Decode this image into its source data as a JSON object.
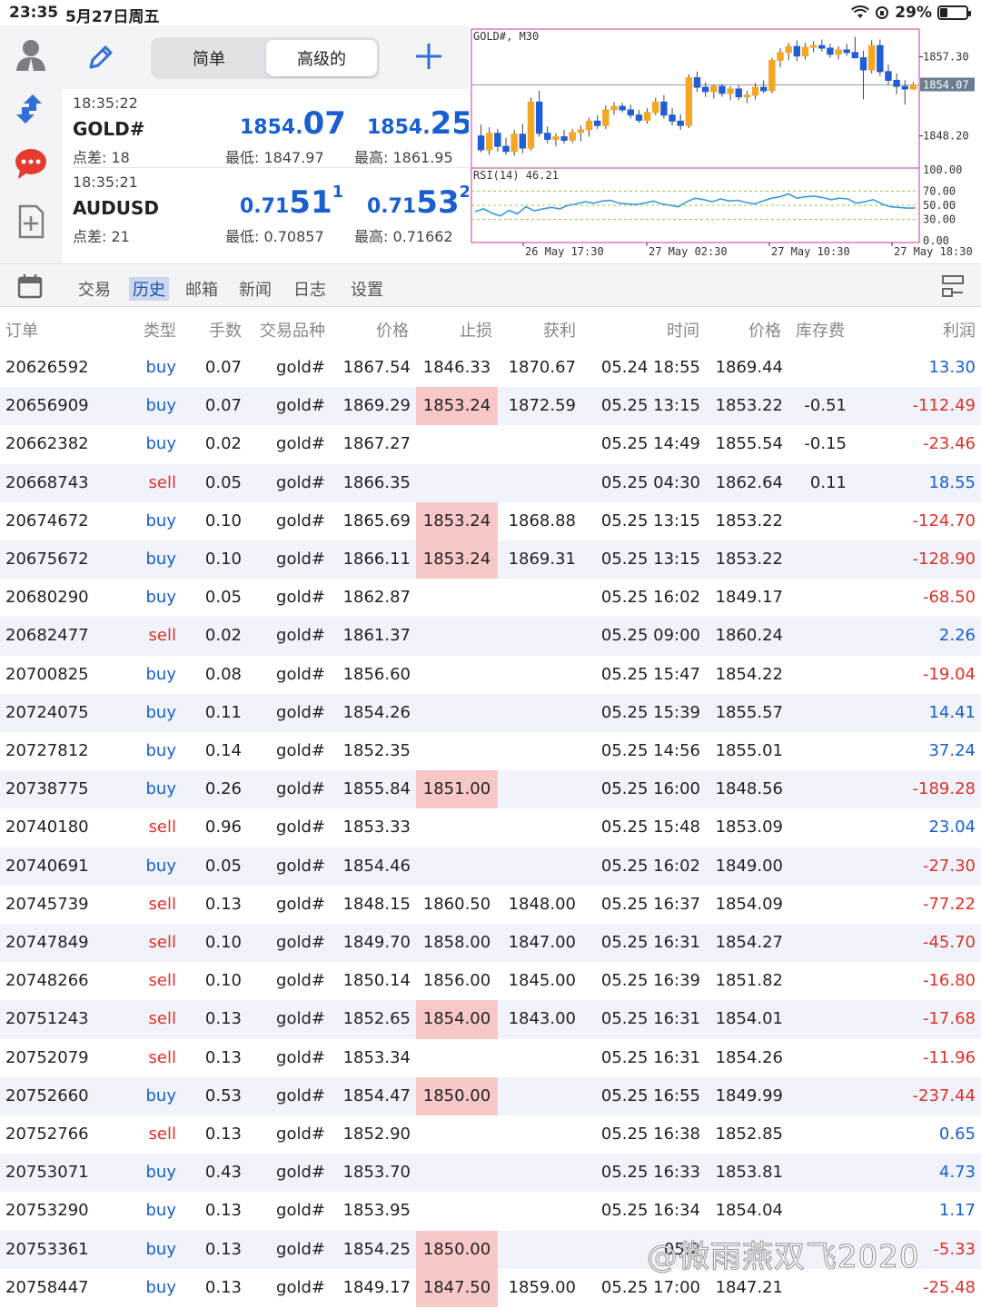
{
  "status_bar": {
    "time": "23:35",
    "date": "5月27日周五",
    "battery": "29%"
  },
  "toolbar": {
    "simple_label": "简单",
    "advanced_label": "高级的"
  },
  "quotes": [
    {
      "time": "18:35:22",
      "symbol": "GOLD#",
      "spread": "点差: 18",
      "bid_small": "1854.",
      "bid_big": "07",
      "bid_sup": "",
      "ask_small": "1854.",
      "ask_big": "25",
      "ask_sup": "",
      "low": "最低: 1847.97",
      "high": "最高: 1861.95"
    },
    {
      "time": "18:35:21",
      "symbol": "AUDUSD",
      "spread": "点差: 21",
      "bid_small": "0.71",
      "bid_big": "51",
      "bid_sup": "1",
      "ask_small": "0.71",
      "ask_big": "53",
      "ask_sup": "2",
      "low": "最低: 0.70857",
      "high": "最高: 0.71662"
    }
  ],
  "chart": {
    "title": "GOLD#, M30",
    "price_ticks": [
      "1857.30",
      "1854.07",
      "1848.20"
    ],
    "rsi_label": "RSI(14) 46.21",
    "rsi_ticks": [
      "100.00",
      "70.00",
      "50.00",
      "30.00",
      "0.00"
    ],
    "time_ticks": [
      "26 May 17:30",
      "27 May 02:30",
      "27 May 10:30",
      "27 May 18:30"
    ],
    "colors": {
      "up": "#f5a623",
      "down": "#1f5fd6",
      "rsi": "#3a9ad9",
      "level": "#9ac43a",
      "frame": "#c8389a"
    }
  },
  "chart_data": {
    "type": "candlestick",
    "title": "GOLD#, M30",
    "price_ylim": [
      1844.5,
      1860.5
    ],
    "current_price": 1854.07,
    "candles": [
      {
        "o": 1848.2,
        "h": 1849.5,
        "l": 1846.3,
        "c": 1846.6
      },
      {
        "o": 1846.6,
        "h": 1849.2,
        "l": 1846.0,
        "c": 1848.5
      },
      {
        "o": 1848.5,
        "h": 1849.0,
        "l": 1846.4,
        "c": 1847.0
      },
      {
        "o": 1847.0,
        "h": 1848.0,
        "l": 1846.0,
        "c": 1846.4
      },
      {
        "o": 1846.4,
        "h": 1848.9,
        "l": 1845.9,
        "c": 1848.4
      },
      {
        "o": 1848.4,
        "h": 1849.6,
        "l": 1846.2,
        "c": 1846.8
      },
      {
        "o": 1846.8,
        "h": 1852.6,
        "l": 1846.5,
        "c": 1852.1
      },
      {
        "o": 1852.1,
        "h": 1853.4,
        "l": 1848.1,
        "c": 1848.5
      },
      {
        "o": 1848.5,
        "h": 1849.3,
        "l": 1847.3,
        "c": 1847.8
      },
      {
        "o": 1847.8,
        "h": 1848.5,
        "l": 1847.0,
        "c": 1848.1
      },
      {
        "o": 1848.1,
        "h": 1848.9,
        "l": 1847.3,
        "c": 1847.7
      },
      {
        "o": 1847.7,
        "h": 1849.0,
        "l": 1847.4,
        "c": 1848.6
      },
      {
        "o": 1848.6,
        "h": 1849.4,
        "l": 1847.6,
        "c": 1848.9
      },
      {
        "o": 1848.9,
        "h": 1850.3,
        "l": 1848.1,
        "c": 1849.9
      },
      {
        "o": 1849.9,
        "h": 1850.6,
        "l": 1849.0,
        "c": 1849.4
      },
      {
        "o": 1849.4,
        "h": 1851.7,
        "l": 1849.0,
        "c": 1851.2
      },
      {
        "o": 1851.2,
        "h": 1852.1,
        "l": 1850.6,
        "c": 1851.6
      },
      {
        "o": 1851.6,
        "h": 1852.0,
        "l": 1850.9,
        "c": 1851.2
      },
      {
        "o": 1851.2,
        "h": 1851.8,
        "l": 1850.2,
        "c": 1850.6
      },
      {
        "o": 1850.6,
        "h": 1851.2,
        "l": 1849.7,
        "c": 1850.0
      },
      {
        "o": 1850.0,
        "h": 1851.4,
        "l": 1849.6,
        "c": 1850.9
      },
      {
        "o": 1850.9,
        "h": 1852.6,
        "l": 1850.6,
        "c": 1852.1
      },
      {
        "o": 1852.1,
        "h": 1852.9,
        "l": 1850.2,
        "c": 1850.6
      },
      {
        "o": 1850.6,
        "h": 1851.4,
        "l": 1849.4,
        "c": 1849.9
      },
      {
        "o": 1849.9,
        "h": 1850.7,
        "l": 1848.9,
        "c": 1849.4
      },
      {
        "o": 1849.4,
        "h": 1855.3,
        "l": 1849.1,
        "c": 1854.9
      },
      {
        "o": 1854.9,
        "h": 1855.6,
        "l": 1853.3,
        "c": 1853.8
      },
      {
        "o": 1853.8,
        "h": 1854.4,
        "l": 1852.7,
        "c": 1853.3
      },
      {
        "o": 1853.3,
        "h": 1854.1,
        "l": 1852.5,
        "c": 1853.9
      },
      {
        "o": 1853.9,
        "h": 1854.2,
        "l": 1852.7,
        "c": 1853.1
      },
      {
        "o": 1853.1,
        "h": 1853.9,
        "l": 1852.3,
        "c": 1853.6
      },
      {
        "o": 1853.6,
        "h": 1854.0,
        "l": 1852.3,
        "c": 1852.7
      },
      {
        "o": 1852.7,
        "h": 1853.4,
        "l": 1852.0,
        "c": 1852.9
      },
      {
        "o": 1852.9,
        "h": 1854.3,
        "l": 1852.4,
        "c": 1853.8
      },
      {
        "o": 1853.8,
        "h": 1854.6,
        "l": 1853.1,
        "c": 1853.4
      },
      {
        "o": 1853.4,
        "h": 1857.2,
        "l": 1853.1,
        "c": 1856.9
      },
      {
        "o": 1856.9,
        "h": 1858.3,
        "l": 1856.1,
        "c": 1857.8
      },
      {
        "o": 1857.8,
        "h": 1858.9,
        "l": 1856.9,
        "c": 1858.5
      },
      {
        "o": 1858.5,
        "h": 1859.2,
        "l": 1856.8,
        "c": 1857.4
      },
      {
        "o": 1857.4,
        "h": 1858.9,
        "l": 1857.0,
        "c": 1858.4
      },
      {
        "o": 1858.4,
        "h": 1859.1,
        "l": 1857.8,
        "c": 1858.6
      },
      {
        "o": 1858.6,
        "h": 1859.3,
        "l": 1857.9,
        "c": 1858.3
      },
      {
        "o": 1858.3,
        "h": 1858.8,
        "l": 1857.2,
        "c": 1857.6
      },
      {
        "o": 1857.6,
        "h": 1858.5,
        "l": 1857.0,
        "c": 1858.1
      },
      {
        "o": 1858.1,
        "h": 1858.8,
        "l": 1857.4,
        "c": 1857.8
      },
      {
        "o": 1857.8,
        "h": 1859.6,
        "l": 1857.1,
        "c": 1857.2
      },
      {
        "o": 1857.2,
        "h": 1858.0,
        "l": 1852.4,
        "c": 1855.8
      },
      {
        "o": 1855.8,
        "h": 1859.2,
        "l": 1855.4,
        "c": 1858.6
      },
      {
        "o": 1858.6,
        "h": 1859.3,
        "l": 1855.1,
        "c": 1855.6
      },
      {
        "o": 1855.6,
        "h": 1856.4,
        "l": 1854.1,
        "c": 1854.6
      },
      {
        "o": 1854.6,
        "h": 1855.4,
        "l": 1853.0,
        "c": 1853.9
      },
      {
        "o": 1853.9,
        "h": 1854.6,
        "l": 1851.8,
        "c": 1853.6
      },
      {
        "o": 1853.6,
        "h": 1854.4,
        "l": 1853.5,
        "c": 1854.07
      }
    ],
    "rsi": {
      "label": "RSI(14) 46.21",
      "ylim": [
        0,
        100
      ],
      "levels": [
        70,
        50,
        30
      ],
      "values": [
        41,
        45,
        39,
        35,
        43,
        38,
        48,
        42,
        45,
        47,
        45,
        50,
        52,
        55,
        53,
        56,
        57,
        53,
        52,
        51,
        53,
        56,
        52,
        50,
        48,
        55,
        60,
        58,
        55,
        59,
        56,
        57,
        54,
        52,
        56,
        60,
        62,
        66,
        60,
        62,
        63,
        61,
        58,
        60,
        59,
        53,
        55,
        58,
        52,
        48,
        47,
        46,
        46.21
      ]
    },
    "x_tick_labels": [
      "26 May 17:30",
      "27 May 02:30",
      "27 May 10:30",
      "27 May 18:30"
    ],
    "y_tick_labels": [
      "1857.30",
      "1854.07",
      "1848.20"
    ],
    "rsi_tick_labels": [
      "100.00",
      "70.00",
      "50.00",
      "30.00",
      "0.00"
    ]
  },
  "tabs": [
    "交易",
    "历史",
    "邮箱",
    "新闻",
    "日志",
    "设置"
  ],
  "table": {
    "headers": {
      "order": "订单",
      "type": "类型",
      "volume": "手数",
      "symbol": "交易品种",
      "price": "价格",
      "sl": "止损",
      "tp": "获利",
      "time": "时间",
      "close_price": "价格",
      "swap": "库存费",
      "profit": "利润"
    },
    "rows": [
      {
        "order": "20626592",
        "type": "buy",
        "volume": "0.07",
        "symbol": "gold#",
        "price": "1867.54",
        "sl": "1846.33",
        "tp": "1870.67",
        "time": "05.24 18:55",
        "close_price": "1869.44",
        "swap": "",
        "profit": "13.30",
        "sl_hit": false
      },
      {
        "order": "20656909",
        "type": "buy",
        "volume": "0.07",
        "symbol": "gold#",
        "price": "1869.29",
        "sl": "1853.24",
        "tp": "1872.59",
        "time": "05.25 13:15",
        "close_price": "1853.22",
        "swap": "-0.51",
        "profit": "-112.49",
        "sl_hit": true
      },
      {
        "order": "20662382",
        "type": "buy",
        "volume": "0.02",
        "symbol": "gold#",
        "price": "1867.27",
        "sl": "",
        "tp": "",
        "time": "05.25 14:49",
        "close_price": "1855.54",
        "swap": "-0.15",
        "profit": "-23.46",
        "sl_hit": false
      },
      {
        "order": "20668743",
        "type": "sell",
        "volume": "0.05",
        "symbol": "gold#",
        "price": "1866.35",
        "sl": "",
        "tp": "",
        "time": "05.25 04:30",
        "close_price": "1862.64",
        "swap": "0.11",
        "profit": "18.55",
        "sl_hit": false
      },
      {
        "order": "20674672",
        "type": "buy",
        "volume": "0.10",
        "symbol": "gold#",
        "price": "1865.69",
        "sl": "1853.24",
        "tp": "1868.88",
        "time": "05.25 13:15",
        "close_price": "1853.22",
        "swap": "",
        "profit": "-124.70",
        "sl_hit": true
      },
      {
        "order": "20675672",
        "type": "buy",
        "volume": "0.10",
        "symbol": "gold#",
        "price": "1866.11",
        "sl": "1853.24",
        "tp": "1869.31",
        "time": "05.25 13:15",
        "close_price": "1853.22",
        "swap": "",
        "profit": "-128.90",
        "sl_hit": true
      },
      {
        "order": "20680290",
        "type": "buy",
        "volume": "0.05",
        "symbol": "gold#",
        "price": "1862.87",
        "sl": "",
        "tp": "",
        "time": "05.25 16:02",
        "close_price": "1849.17",
        "swap": "",
        "profit": "-68.50",
        "sl_hit": false
      },
      {
        "order": "20682477",
        "type": "sell",
        "volume": "0.02",
        "symbol": "gold#",
        "price": "1861.37",
        "sl": "",
        "tp": "",
        "time": "05.25 09:00",
        "close_price": "1860.24",
        "swap": "",
        "profit": "2.26",
        "sl_hit": false
      },
      {
        "order": "20700825",
        "type": "buy",
        "volume": "0.08",
        "symbol": "gold#",
        "price": "1856.60",
        "sl": "",
        "tp": "",
        "time": "05.25 15:47",
        "close_price": "1854.22",
        "swap": "",
        "profit": "-19.04",
        "sl_hit": false
      },
      {
        "order": "20724075",
        "type": "buy",
        "volume": "0.11",
        "symbol": "gold#",
        "price": "1854.26",
        "sl": "",
        "tp": "",
        "time": "05.25 15:39",
        "close_price": "1855.57",
        "swap": "",
        "profit": "14.41",
        "sl_hit": false
      },
      {
        "order": "20727812",
        "type": "buy",
        "volume": "0.14",
        "symbol": "gold#",
        "price": "1852.35",
        "sl": "",
        "tp": "",
        "time": "05.25 14:56",
        "close_price": "1855.01",
        "swap": "",
        "profit": "37.24",
        "sl_hit": false
      },
      {
        "order": "20738775",
        "type": "buy",
        "volume": "0.26",
        "symbol": "gold#",
        "price": "1855.84",
        "sl": "1851.00",
        "tp": "",
        "time": "05.25 16:00",
        "close_price": "1848.56",
        "swap": "",
        "profit": "-189.28",
        "sl_hit": true
      },
      {
        "order": "20740180",
        "type": "sell",
        "volume": "0.96",
        "symbol": "gold#",
        "price": "1853.33",
        "sl": "",
        "tp": "",
        "time": "05.25 15:48",
        "close_price": "1853.09",
        "swap": "",
        "profit": "23.04",
        "sl_hit": false
      },
      {
        "order": "20740691",
        "type": "buy",
        "volume": "0.05",
        "symbol": "gold#",
        "price": "1854.46",
        "sl": "",
        "tp": "",
        "time": "05.25 16:02",
        "close_price": "1849.00",
        "swap": "",
        "profit": "-27.30",
        "sl_hit": false
      },
      {
        "order": "20745739",
        "type": "sell",
        "volume": "0.13",
        "symbol": "gold#",
        "price": "1848.15",
        "sl": "1860.50",
        "tp": "1848.00",
        "time": "05.25 16:37",
        "close_price": "1854.09",
        "swap": "",
        "profit": "-77.22",
        "sl_hit": false
      },
      {
        "order": "20747849",
        "type": "sell",
        "volume": "0.10",
        "symbol": "gold#",
        "price": "1849.70",
        "sl": "1858.00",
        "tp": "1847.00",
        "time": "05.25 16:31",
        "close_price": "1854.27",
        "swap": "",
        "profit": "-45.70",
        "sl_hit": false
      },
      {
        "order": "20748266",
        "type": "sell",
        "volume": "0.10",
        "symbol": "gold#",
        "price": "1850.14",
        "sl": "1856.00",
        "tp": "1845.00",
        "time": "05.25 16:39",
        "close_price": "1851.82",
        "swap": "",
        "profit": "-16.80",
        "sl_hit": false
      },
      {
        "order": "20751243",
        "type": "sell",
        "volume": "0.13",
        "symbol": "gold#",
        "price": "1852.65",
        "sl": "1854.00",
        "tp": "1843.00",
        "time": "05.25 16:31",
        "close_price": "1854.01",
        "swap": "",
        "profit": "-17.68",
        "sl_hit": true
      },
      {
        "order": "20752079",
        "type": "sell",
        "volume": "0.13",
        "symbol": "gold#",
        "price": "1853.34",
        "sl": "",
        "tp": "",
        "time": "05.25 16:31",
        "close_price": "1854.26",
        "swap": "",
        "profit": "-11.96",
        "sl_hit": false
      },
      {
        "order": "20752660",
        "type": "buy",
        "volume": "0.53",
        "symbol": "gold#",
        "price": "1854.47",
        "sl": "1850.00",
        "tp": "",
        "time": "05.25 16:55",
        "close_price": "1849.99",
        "swap": "",
        "profit": "-237.44",
        "sl_hit": true
      },
      {
        "order": "20752766",
        "type": "sell",
        "volume": "0.13",
        "symbol": "gold#",
        "price": "1852.90",
        "sl": "",
        "tp": "",
        "time": "05.25 16:38",
        "close_price": "1852.85",
        "swap": "",
        "profit": "0.65",
        "sl_hit": false
      },
      {
        "order": "20753071",
        "type": "buy",
        "volume": "0.43",
        "symbol": "gold#",
        "price": "1853.70",
        "sl": "",
        "tp": "",
        "time": "05.25 16:33",
        "close_price": "1853.81",
        "swap": "",
        "profit": "4.73",
        "sl_hit": false
      },
      {
        "order": "20753290",
        "type": "buy",
        "volume": "0.13",
        "symbol": "gold#",
        "price": "1853.95",
        "sl": "",
        "tp": "",
        "time": "05.25 16:34",
        "close_price": "1854.04",
        "swap": "",
        "profit": "1.17",
        "sl_hit": false
      },
      {
        "order": "20753361",
        "type": "buy",
        "volume": "0.13",
        "symbol": "gold#",
        "price": "1854.25",
        "sl": "1850.00",
        "tp": "",
        "time": "05.2",
        "close_price": "",
        "swap": "",
        "profit": "-5.33",
        "sl_hit": true
      },
      {
        "order": "20758447",
        "type": "buy",
        "volume": "0.13",
        "symbol": "gold#",
        "price": "1849.17",
        "sl": "1847.50",
        "tp": "1859.00",
        "time": "05.25 17:00",
        "close_price": "1847.21",
        "swap": "",
        "profit": "-25.48",
        "sl_hit": true
      }
    ]
  },
  "watermark": "@微雨燕双飞2020"
}
